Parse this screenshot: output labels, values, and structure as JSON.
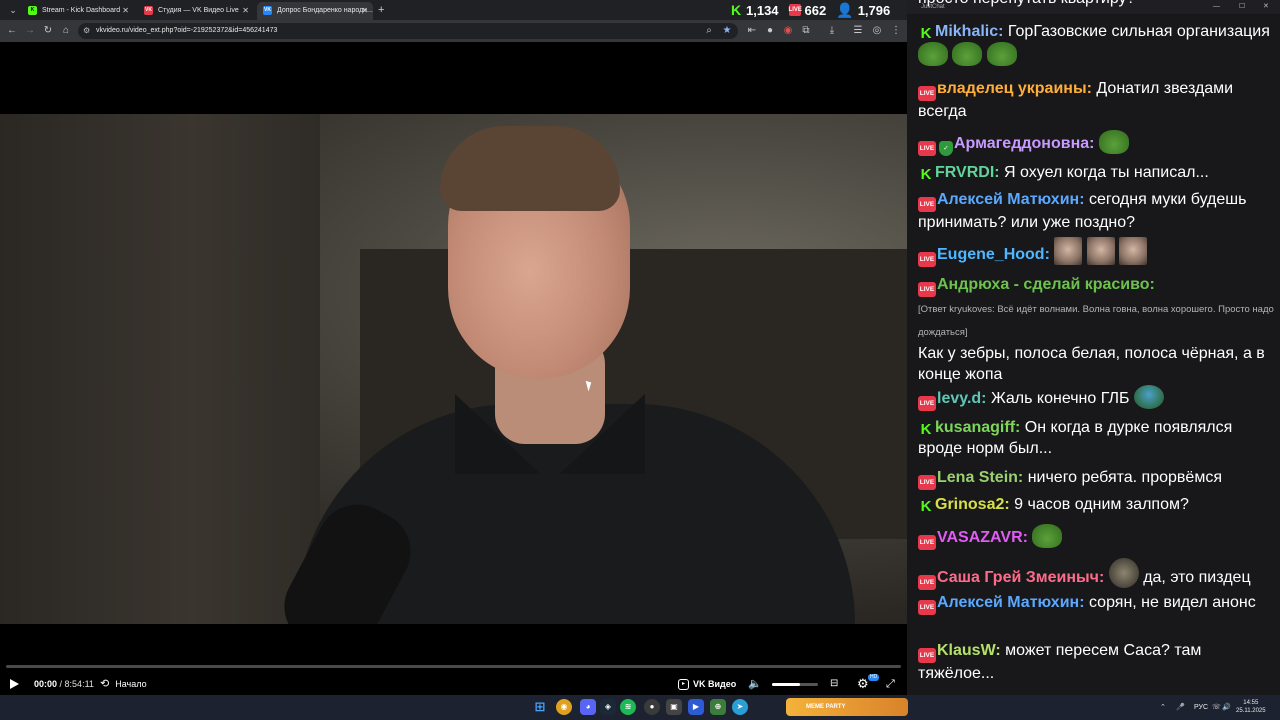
{
  "browser": {
    "tabs": [
      {
        "label": "Stream - Kick Dashboard",
        "favicon": "K",
        "color": "#53fc18"
      },
      {
        "label": "Студия — VK Видео Live",
        "favicon": "VK",
        "color": "#e8384c"
      },
      {
        "label": "Допрос Бондаренко народн...",
        "favicon": "VK",
        "color": "#2787f5"
      }
    ],
    "url": "vkvideo.ru/video_ext.php?oid=-219252372&id=456241473"
  },
  "counters": {
    "kick": "1,134",
    "vk_live": "662",
    "total": "1,796"
  },
  "player": {
    "current_time": "00:00",
    "separator": " / ",
    "duration": "8:54:11",
    "restart_label": "Начало",
    "brand_label": "VK Видео",
    "quality_badge": "HD",
    "progress": 0.0,
    "volume": 0.6
  },
  "chat": {
    "window_title": "JustChat",
    "messages": [
      {
        "platform": "live",
        "name": "",
        "text": "просто перепутать квартиру?",
        "color": "#ffffff"
      },
      {
        "platform": "kick",
        "name": "Mikhalic:",
        "text": "ГорГазовские сильная организация",
        "color": "#8ab4f8",
        "emotes": [
          "pepe",
          "pepe",
          "pepe"
        ]
      },
      {
        "platform": "live",
        "name": "владелец украины:",
        "text": "Донатил звездами всегда",
        "color": "#ffae3b"
      },
      {
        "platform": "live",
        "name": "Армагеддоновна:",
        "text": "",
        "color": "#c79aff",
        "mod": true,
        "emotes": [
          "pepe"
        ]
      },
      {
        "platform": "kick",
        "name": "FRVRDI:",
        "text": "Я охуел когда ты написал...",
        "color": "#62d39a"
      },
      {
        "platform": "live",
        "name": "Алексей Матюхин:",
        "text": "сегодня муки будешь принимать? или уже поздно?",
        "color": "#5aa9ff"
      },
      {
        "platform": "live",
        "name": "Eugene_Hood:",
        "text": "",
        "color": "#4db8ff",
        "emotes": [
          "face",
          "face",
          "face"
        ]
      },
      {
        "platform": "live",
        "name": "Андрюха - сделай красиво:",
        "reply": "[Ответ kryukoves: Всё идёт волнами. Волна говна, волна хорошего. Просто надо дождаться]",
        "text": "Как у зебры, полоса белая, полоса чёрная, а в конце жопа",
        "color": "#6cc24a"
      },
      {
        "platform": "live",
        "name": "levy.d:",
        "text": "Жаль конечно ГЛБ",
        "color": "#5fc7b3",
        "emotes": [
          "umbrella"
        ]
      },
      {
        "platform": "kick",
        "name": "kusanagiff:",
        "text": "Он когда в дурке появлялся вроде норм был...",
        "color": "#7dd65a"
      },
      {
        "platform": "live",
        "name": "Lena Stein:",
        "text": "ничего ребята. прорвёмся",
        "color": "#9ad06e"
      },
      {
        "platform": "kick",
        "name": "Grinosa2:",
        "text": "9 часов одним залпом?",
        "color": "#d6e04a"
      },
      {
        "platform": "live",
        "name": "VASAZAVR:",
        "text": "",
        "color": "#e05cf5",
        "emotes": [
          "pepe"
        ]
      },
      {
        "platform": "live",
        "name": "Саша Грей Змеиныч:",
        "text": "да, это пиздец",
        "color": "#ff6b8a",
        "emotes_before": [
          "monkey"
        ]
      },
      {
        "platform": "live",
        "name": "Алексей Матюхин:",
        "text": "сорян, не видел анонс",
        "color": "#5aa9ff"
      },
      {
        "platform": "live",
        "name": "KlausW:",
        "text": "может пересем Саса? там тяжёлое...",
        "color": "#b5e06a"
      }
    ]
  },
  "taskbar": {
    "banner": "MEME PARTY",
    "lang": "РУС",
    "time": "14:55",
    "date": "25.11.2025"
  },
  "colors": {
    "kick_green": "#53fc18",
    "vk_live_red": "#e8384c",
    "vk_blue": "#2787f5",
    "chat_bg": "#18181b"
  }
}
